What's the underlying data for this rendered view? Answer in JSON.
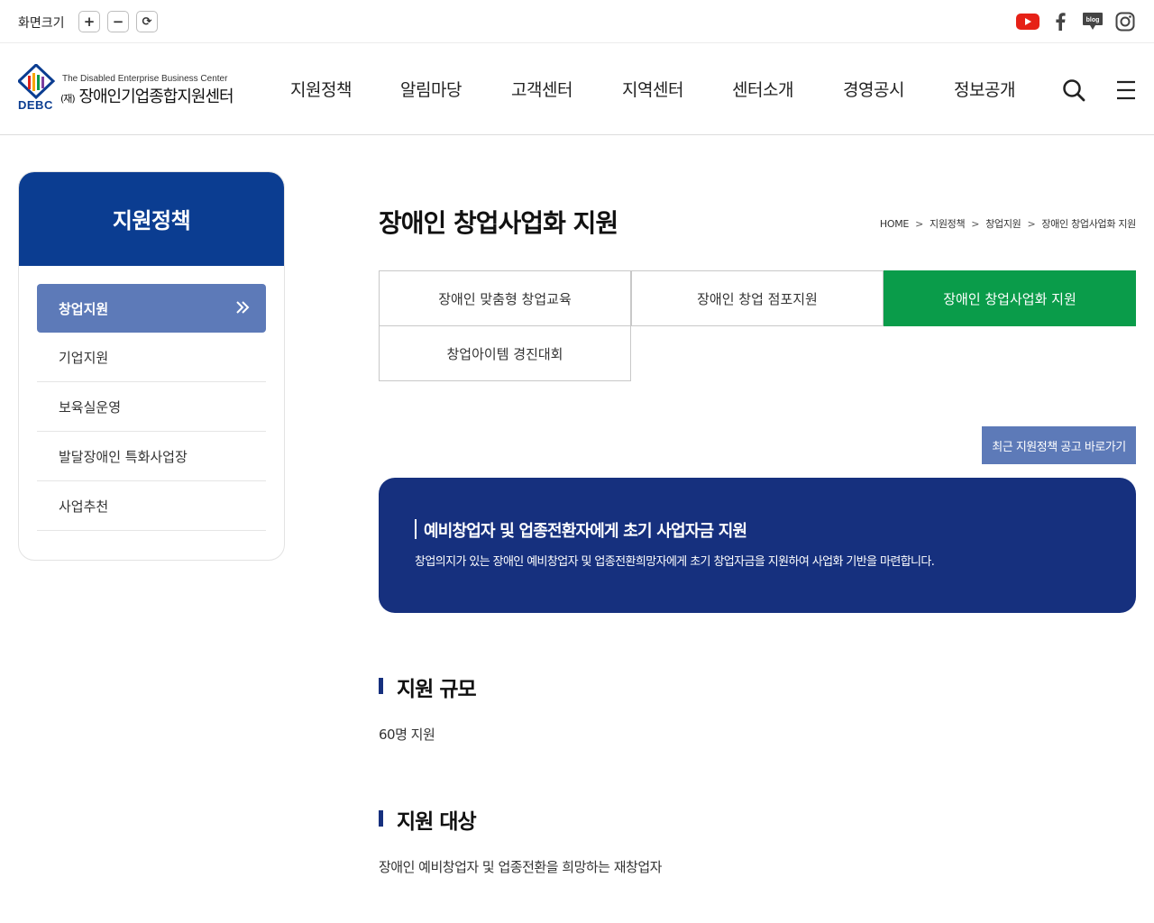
{
  "util": {
    "zoom_label": "화면크기",
    "zoom_in": "+",
    "zoom_out": "−",
    "zoom_reset": "⟳",
    "sns": [
      {
        "icon": "youtube-icon",
        "color": "#e62117"
      },
      {
        "icon": "facebook-icon",
        "color": "#444444"
      },
      {
        "icon": "blog-icon",
        "label": "blog",
        "color": "#444444"
      },
      {
        "icon": "instagram-icon",
        "color": "#444444"
      }
    ]
  },
  "logo": {
    "abbr": "DEBC",
    "en": "The Disabled Enterprise Business Center",
    "ko_prefix": "(재)",
    "ko": "장애인기업종합지원센터"
  },
  "gnb": [
    "지원정책",
    "알림마당",
    "고객센터",
    "지역센터",
    "센터소개",
    "경영공시",
    "정보공개"
  ],
  "lnb": {
    "title": "지원정책",
    "items": [
      "창업지원",
      "기업지원",
      "보육실운영",
      "발달장애인 특화사업장",
      "사업추천"
    ]
  },
  "page": {
    "title": "장애인 창업사업화 지원",
    "breadcrumb": [
      "HOME",
      "지원정책",
      "창업지원",
      "장애인 창업사업화 지원"
    ],
    "tabs": [
      "장애인 맞춤형 창업교육",
      "장애인 창업 점포지원",
      "장애인 창업사업화 지원",
      "창업아이템 경진대회"
    ],
    "notice_button": "최근 지원정책 공고 바로가기",
    "banner": {
      "title": "예비창업자 및 업종전환자에게 초기 사업자금 지원",
      "desc": "창업의지가 있는 장애인 예비창업자 및 업종전환희망자에게 초기 창업자금을 지원하여 사업화 기반을 마련합니다."
    },
    "sections": [
      {
        "title": "지원 규모",
        "text": "60명 지원"
      },
      {
        "title": "지원 대상",
        "text": "장애인 예비창업자 및 업종전환을 희망하는 재창업자"
      }
    ]
  },
  "colors": {
    "primary_navy": "#0b3d91",
    "banner_navy": "#16307e",
    "active_tab_green": "#0a9c4a",
    "active_menu_blue": "#5d7ab8"
  }
}
